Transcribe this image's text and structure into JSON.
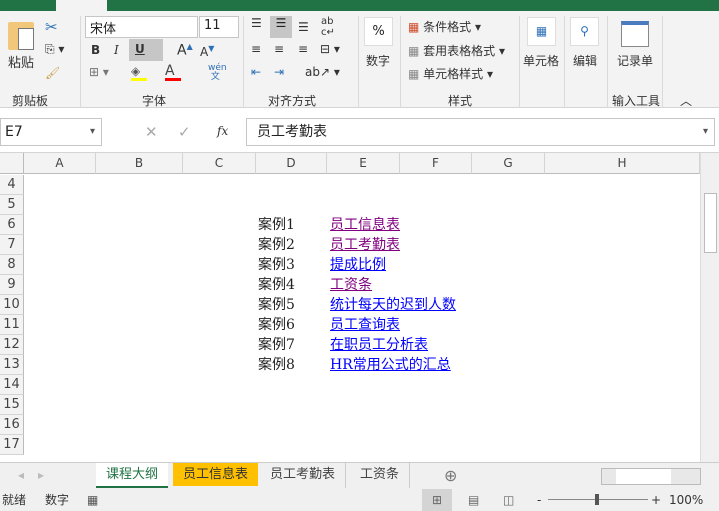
{
  "ribbon": {
    "clipboard": {
      "paste": "粘贴",
      "group": "剪贴板"
    },
    "font": {
      "name": "宋体",
      "size": "11",
      "bold": "B",
      "italic": "I",
      "underline": "U",
      "phonetic": "wén\n文",
      "group": "字体"
    },
    "alignment": {
      "group": "对齐方式"
    },
    "number": {
      "label": "数字",
      "symbol": "%"
    },
    "styles": {
      "conditional": "条件格式",
      "table": "套用表格格式",
      "cell": "单元格样式",
      "group": "样式"
    },
    "cells": {
      "label": "单元格"
    },
    "editing": {
      "label": "编辑"
    },
    "form": {
      "label": "记录单",
      "group": "输入工具"
    },
    "colors": {
      "fill": "#ffff00",
      "font": "#ff0000",
      "accent": "#217346"
    }
  },
  "formula_bar": {
    "name_box": "E7",
    "fx": "fx",
    "value": "员工考勤表"
  },
  "columns": [
    "A",
    "B",
    "C",
    "D",
    "E",
    "F",
    "G",
    "H"
  ],
  "rows": [
    "4",
    "5",
    "6",
    "7",
    "8",
    "9",
    "10",
    "11",
    "12",
    "13",
    "14",
    "15",
    "16",
    "17"
  ],
  "cases": [
    {
      "label": "案例1",
      "link": "员工信息表",
      "visited": true
    },
    {
      "label": "案例2",
      "link": "员工考勤表",
      "visited": true
    },
    {
      "label": "案例3",
      "link": "提成比例",
      "visited": false
    },
    {
      "label": "案例4",
      "link": "工资条",
      "visited": true
    },
    {
      "label": "案例5",
      "link": "统计每天的迟到人数",
      "visited": false
    },
    {
      "label": "案例6",
      "link": "员工查询表",
      "visited": false
    },
    {
      "label": "案例7",
      "link": "在职员工分析表",
      "visited": false
    },
    {
      "label": "案例8",
      "link": "HR常用公式的汇总",
      "visited": false
    }
  ],
  "sheets": [
    {
      "label": "课程大纲",
      "active": true
    },
    {
      "label": "员工信息表",
      "highlight": "#ffc000"
    },
    {
      "label": "员工考勤表"
    },
    {
      "label": "工资条"
    }
  ],
  "status": {
    "ready": "就绪",
    "mode": "数字",
    "zoom": "100%",
    "zoom_minus": "-",
    "zoom_plus": "+"
  }
}
